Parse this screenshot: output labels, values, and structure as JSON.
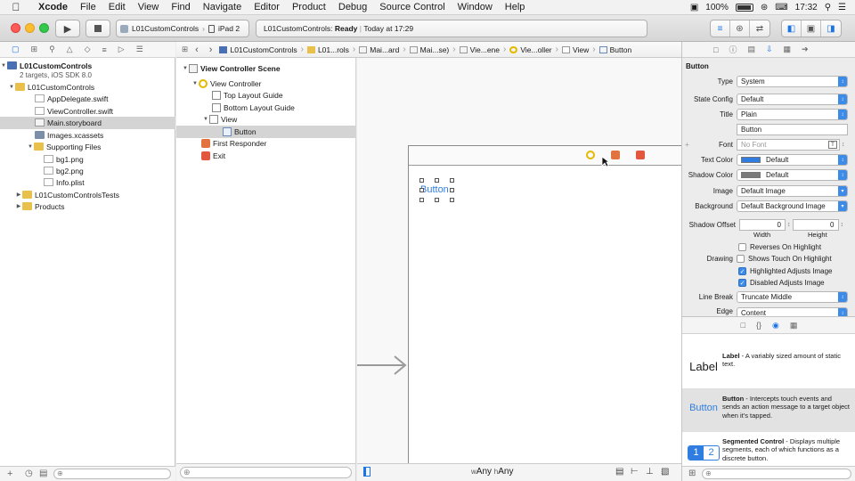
{
  "menubar": {
    "items": [
      "Xcode",
      "File",
      "Edit",
      "View",
      "Find",
      "Navigate",
      "Editor",
      "Product",
      "Debug",
      "Source Control",
      "Window",
      "Help"
    ],
    "battery": "100%",
    "time": "17:32"
  },
  "toolbar": {
    "scheme": "L01CustomControls",
    "destination": "iPad 2",
    "activity_project": "L01CustomControls:",
    "activity_status": "Ready",
    "activity_sep": "|",
    "activity_time": "Today at 17:29"
  },
  "navigator": {
    "project_name": "L01CustomControls",
    "project_subtitle": "2 targets, iOS SDK 8.0",
    "items": [
      {
        "label": "L01CustomControls",
        "icon": "folder"
      },
      {
        "label": "AppDelegate.swift",
        "icon": "swift"
      },
      {
        "label": "ViewController.swift",
        "icon": "swift"
      },
      {
        "label": "Main.storyboard",
        "icon": "storyboard"
      },
      {
        "label": "Images.xcassets",
        "icon": "assets"
      },
      {
        "label": "Supporting Files",
        "icon": "folder"
      },
      {
        "label": "bg1.png",
        "icon": "png"
      },
      {
        "label": "bg2.png",
        "icon": "png"
      },
      {
        "label": "Info.plist",
        "icon": "png"
      },
      {
        "label": "L01CustomControlsTests",
        "icon": "folder"
      },
      {
        "label": "Products",
        "icon": "folder"
      }
    ]
  },
  "jumpbar": {
    "crumbs": [
      "L01CustomControls",
      "L01...rols",
      "Mai...ard",
      "Mai...se)",
      "Vie...ene",
      "Vie...oller",
      "View",
      "Button"
    ]
  },
  "outline": {
    "items": [
      "View Controller Scene",
      "View Controller",
      "Top Layout Guide",
      "Bottom Layout Guide",
      "View",
      "Button",
      "First Responder",
      "Exit"
    ]
  },
  "canvas": {
    "button_title": "Button",
    "size_class_w": "w",
    "size_class_any1": "Any",
    "size_class_h": "h",
    "size_class_any2": "Any"
  },
  "inspector": {
    "section_title": "Button",
    "type_label": "Type",
    "type_value": "System",
    "state_label": "State Config",
    "state_value": "Default",
    "title_label": "Title",
    "title_value": "Plain",
    "title_text": "Button",
    "font_label": "Font",
    "font_value": "No Font",
    "text_color_label": "Text Color",
    "text_color_value": "Default",
    "text_color_swatch": "#2f7de1",
    "shadow_color_label": "Shadow Color",
    "shadow_color_value": "Default",
    "shadow_color_swatch": "#7a7a7a",
    "image_label": "Image",
    "image_value": "Default Image",
    "background_label": "Background",
    "background_value": "Default Background Image",
    "shadow_offset_label": "Shadow Offset",
    "shadow_offset_w": "0",
    "shadow_offset_h": "0",
    "width_label": "Width",
    "height_label": "Height",
    "drawing_label": "Drawing",
    "checkboxes": [
      {
        "label": "Reverses On Highlight",
        "checked": false
      },
      {
        "label": "Shows Touch On Highlight",
        "checked": false
      },
      {
        "label": "Highlighted Adjusts Image",
        "checked": true
      },
      {
        "label": "Disabled Adjusts Image",
        "checked": true
      }
    ],
    "line_break_label": "Line Break",
    "line_break_value": "Truncate Middle",
    "edge_label": "Edge",
    "edge_value": "Content"
  },
  "library": {
    "items": [
      {
        "icon_text": "Label",
        "name": "Label",
        "desc": " - A variably sized amount of static text."
      },
      {
        "icon_text": "Button",
        "name": "Button",
        "desc": " - Intercepts touch events and sends an action message to a target object when it's tapped."
      },
      {
        "icon_text": "1 2",
        "name": "Segmented Control",
        "desc": " - Displays multiple segments, each of which functions as a discrete button."
      }
    ]
  },
  "colors": {
    "accent": "#3d8be8",
    "selection": "#d4d4d4"
  }
}
